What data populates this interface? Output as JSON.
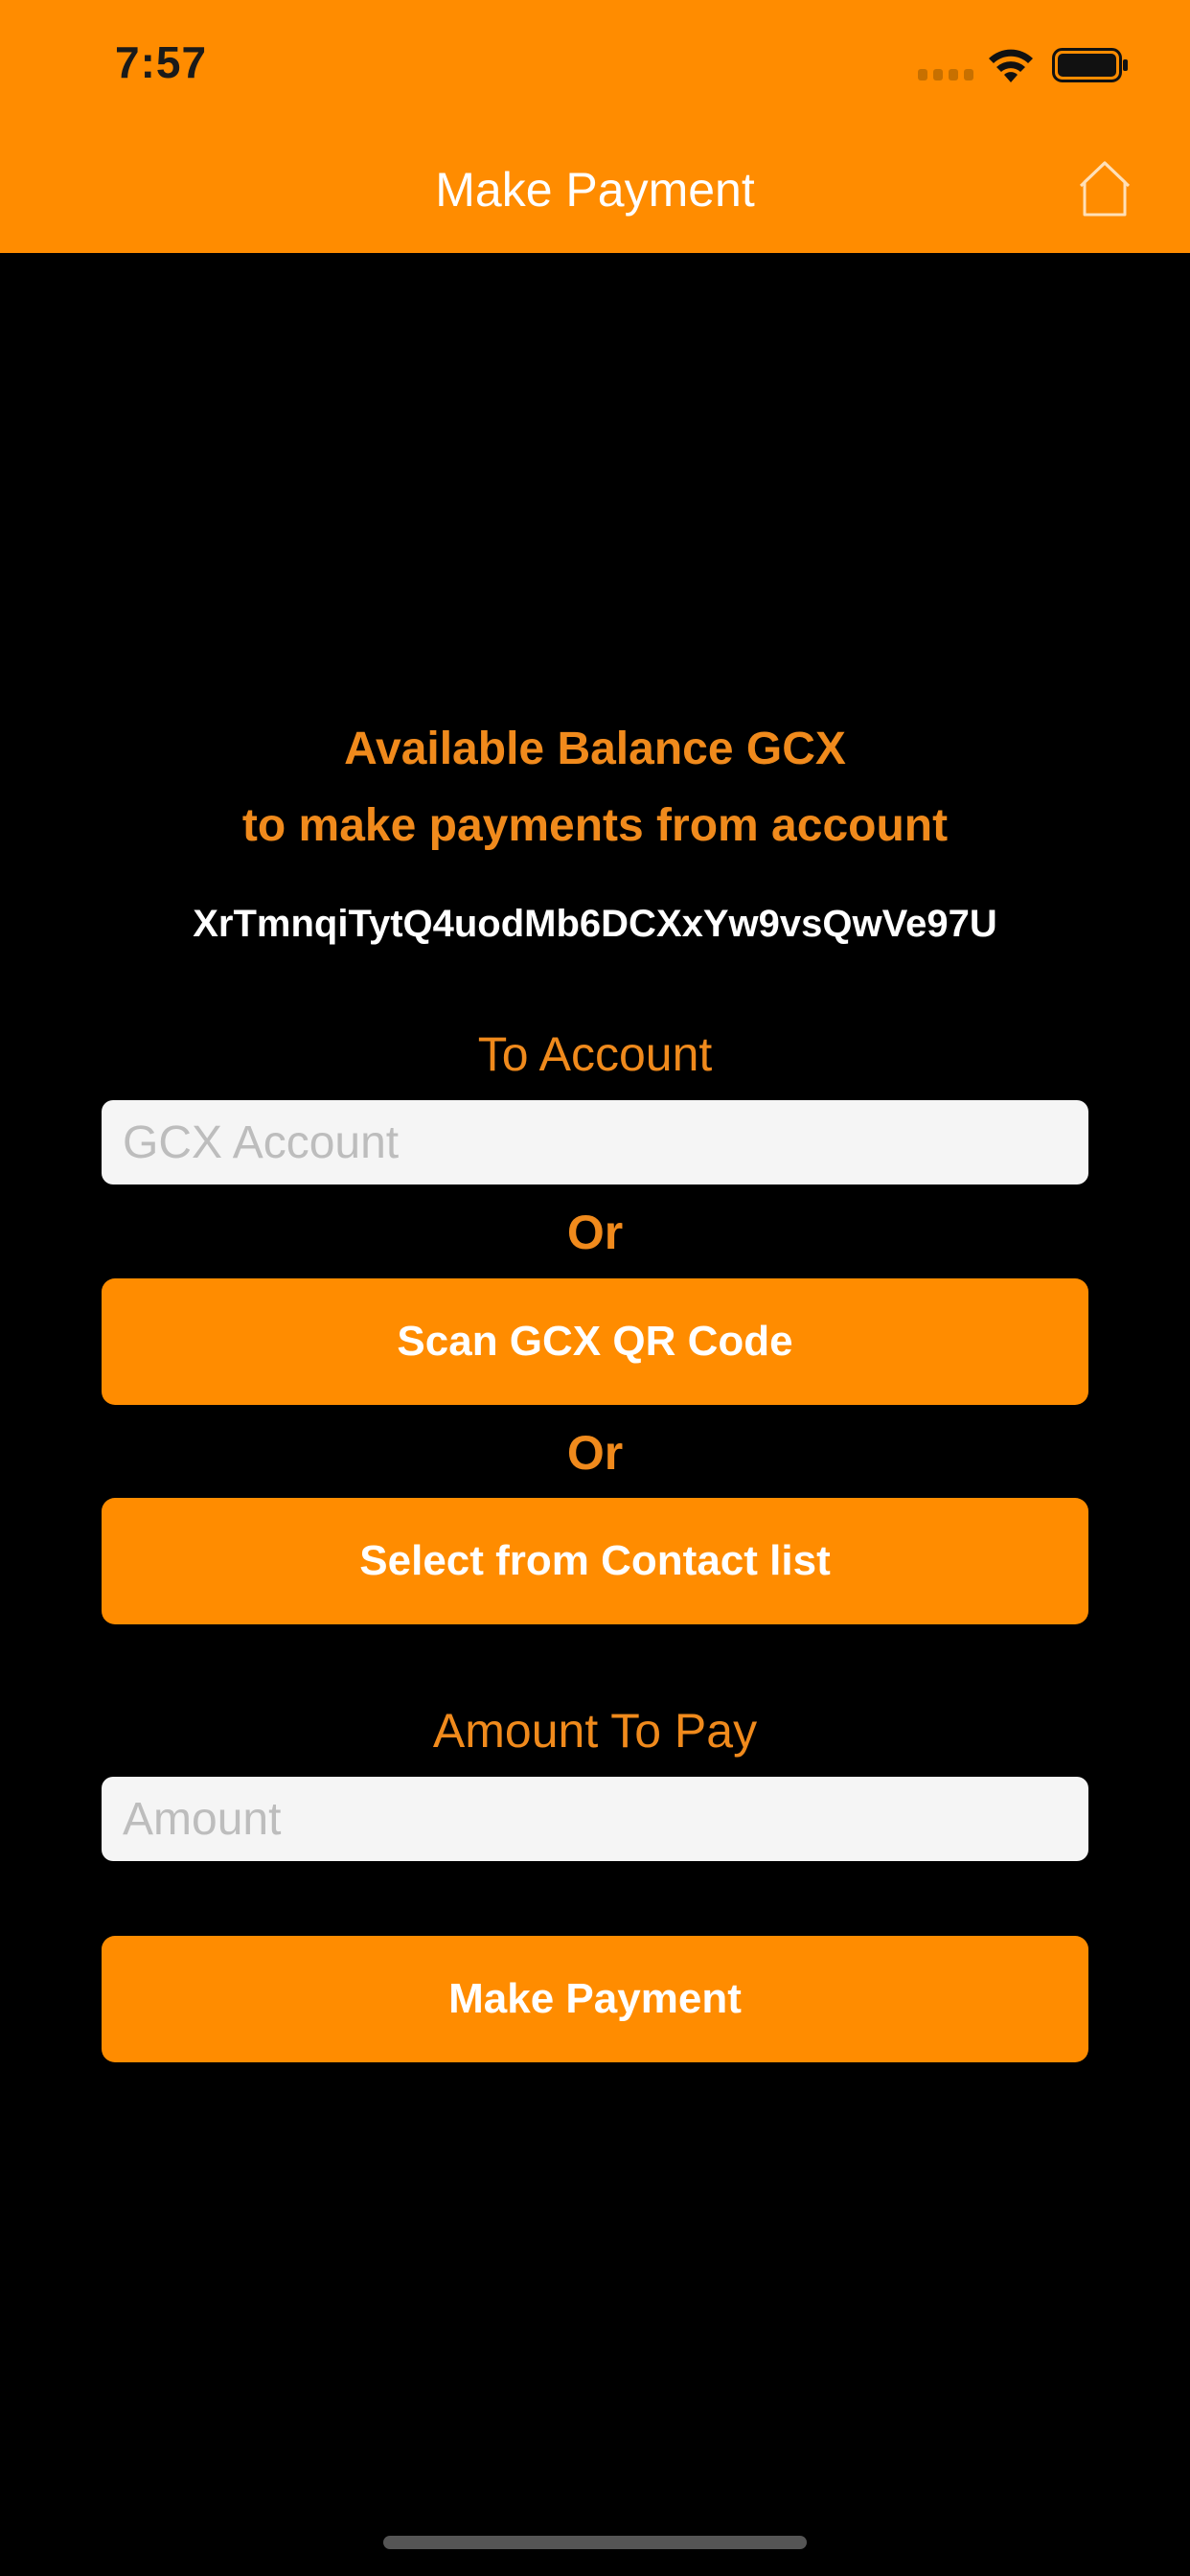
{
  "status_bar": {
    "time": "7:57"
  },
  "nav": {
    "title": "Make Payment",
    "home_icon": "home-icon"
  },
  "balance": {
    "line1": "Available Balance  GCX",
    "line2": "to make payments from account",
    "account_address": "XrTmnqiTytQ4uodMb6DCXxYw9vsQwVe97U"
  },
  "form": {
    "to_account_label": "To Account",
    "gcx_account_placeholder": "GCX Account",
    "gcx_account_value": "",
    "or_label_1": "Or",
    "scan_qr_label": "Scan GCX QR Code",
    "or_label_2": "Or",
    "contact_list_label": "Select from Contact list",
    "amount_label": "Amount To Pay",
    "amount_placeholder": "Amount",
    "amount_value": "",
    "make_payment_label": "Make Payment"
  },
  "colors": {
    "accent": "#FF8C00",
    "label_text": "#F08A1C",
    "background": "#000000"
  }
}
